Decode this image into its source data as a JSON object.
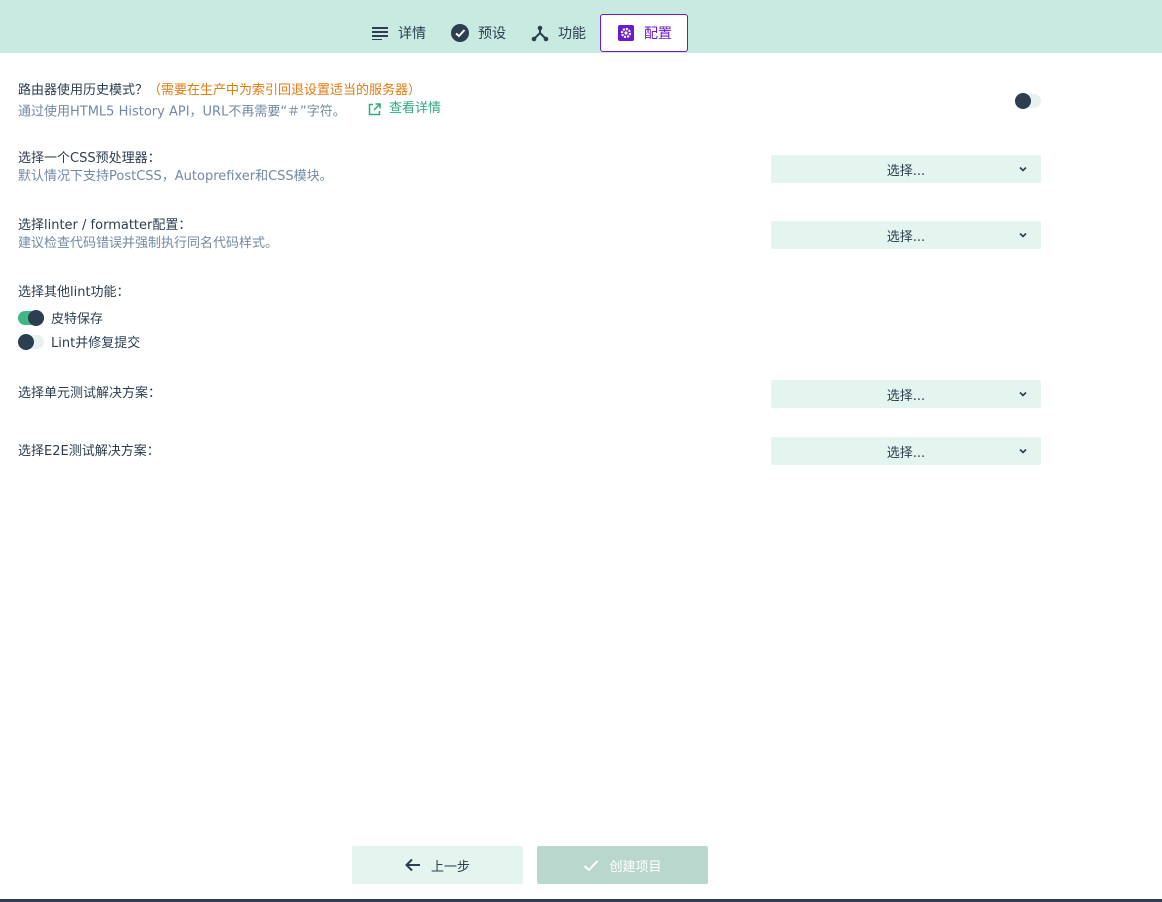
{
  "tabs": [
    {
      "label": "详情",
      "icon": "details-list-icon"
    },
    {
      "label": "预设",
      "icon": "check-circle-icon"
    },
    {
      "label": "功能",
      "icon": "features-icon"
    },
    {
      "label": "配置",
      "icon": "gear-icon",
      "active": true
    }
  ],
  "history": {
    "label": "路由器使用历史模式？",
    "warning": "（需要在生产中为索引回退设置适当的服务器）",
    "desc": "通过使用HTML5 History API，URL不再需要“＃”字符。",
    "link": "查看详情",
    "enabled": false
  },
  "css": {
    "label": "选择一个CSS预处理器：",
    "desc": "默认情况下支持PostCSS，Autoprefixer和CSS模块。",
    "value": "选择..."
  },
  "linter": {
    "label": "选择linter / formatter配置：",
    "desc": "建议检查代码错误并强制执行同名代码样式。",
    "value": "选择..."
  },
  "lint": {
    "label": "选择其他lint功能：",
    "options": [
      {
        "label": "皮特保存",
        "enabled": true
      },
      {
        "label": "Lint并修复提交",
        "enabled": false
      }
    ]
  },
  "unit": {
    "label": "选择单元测试解决方案：",
    "value": "选择..."
  },
  "e2e": {
    "label": "选择E2E测试解决方案：",
    "value": "选择..."
  },
  "footer": {
    "prev": "上一步",
    "create": "创建项目"
  },
  "colors": {
    "topbar": "#c8eae0",
    "accent": "#6a1ac9",
    "warning": "#e27b12",
    "link": "#2eaa7d",
    "toggle_on": "#3fb885"
  }
}
